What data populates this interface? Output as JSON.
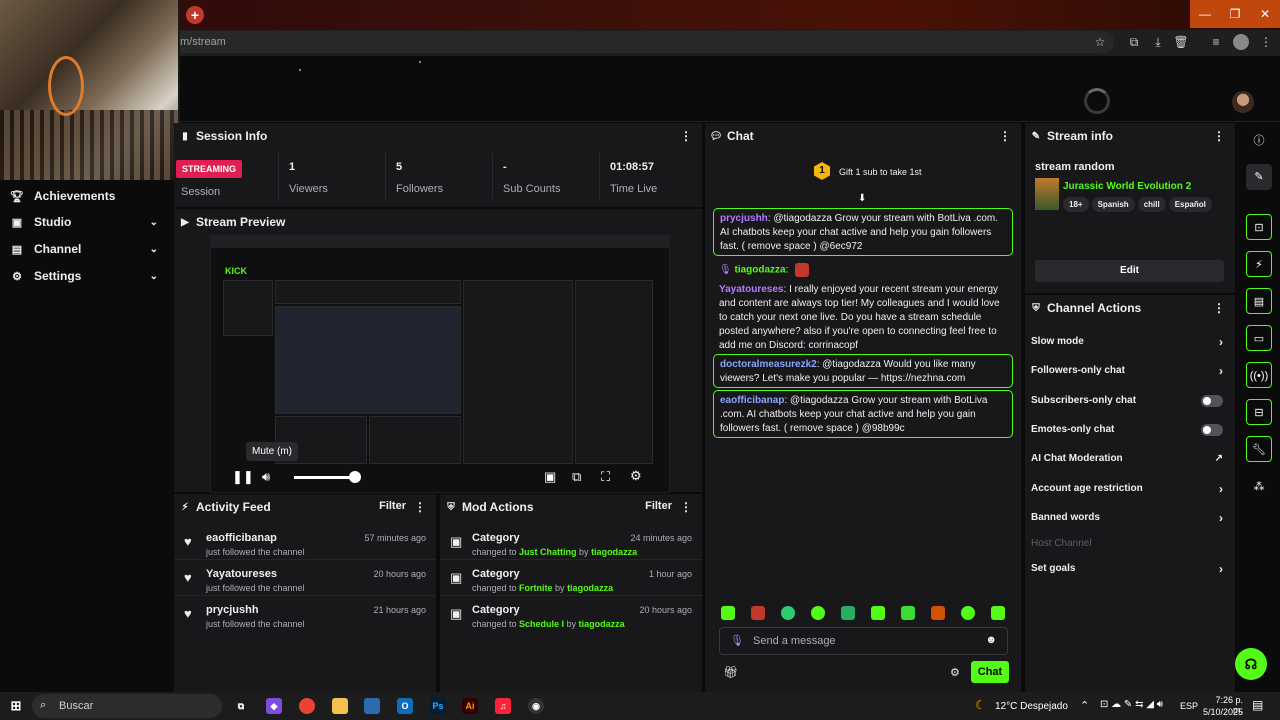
{
  "browser": {
    "url": "m/stream",
    "window_controls": {
      "minimize": "—",
      "maximize": "❐",
      "close": "✕"
    }
  },
  "nav": {
    "items": [
      {
        "label": "Achievements",
        "icon": "trophy-icon",
        "chev": ""
      },
      {
        "label": "Studio",
        "icon": "studio-icon",
        "chev": "⌄"
      },
      {
        "label": "Channel",
        "icon": "channel-icon",
        "chev": "⌄"
      },
      {
        "label": "Settings",
        "icon": "gear-icon",
        "chev": "⌄"
      }
    ]
  },
  "session": {
    "title": "Session Info",
    "status": "STREAMING",
    "status_label": "Session",
    "stats": [
      {
        "value": "1",
        "label": "Viewers"
      },
      {
        "value": "5",
        "label": "Followers"
      },
      {
        "value": "-",
        "label": "Sub Counts"
      },
      {
        "value": "01:08:57",
        "label": "Time Live"
      }
    ]
  },
  "preview": {
    "title": "Stream Preview",
    "tooltip": "Mute (m)",
    "volume_percent": 100,
    "inner_logo": "KICK"
  },
  "activity": {
    "title": "Activity Feed",
    "filter": "Filter",
    "rows": [
      {
        "name": "eaofficibanap",
        "sub": "just followed the channel",
        "time": "57 minutes ago"
      },
      {
        "name": "Yayatoureses",
        "sub": "just followed the channel",
        "time": "20 hours ago"
      },
      {
        "name": "prycjushh",
        "sub": "just followed the channel",
        "time": "21 hours ago"
      }
    ]
  },
  "mod": {
    "title": "Mod Actions",
    "filter": "Filter",
    "rows": [
      {
        "name": "Category",
        "pre": "changed to ",
        "target": "Just Chatting",
        "by": " by ",
        "user": "tiagodazza",
        "time": "24 minutes ago"
      },
      {
        "name": "Category",
        "pre": "changed to ",
        "target": "Fortnite",
        "by": " by ",
        "user": "tiagodazza",
        "time": "1 hour ago"
      },
      {
        "name": "Category",
        "pre": "changed to ",
        "target": "Schedule I",
        "by": " by ",
        "user": "tiagodazza",
        "time": "20 hours ago"
      }
    ]
  },
  "chat": {
    "title": "Chat",
    "gift_text": "Gift 1 sub to take 1st",
    "gift_count": "1",
    "messages": [
      {
        "user": "prycjushh",
        "text": "@tiagodazza Grow your stream with BotLiva .com. AI chatbots keep your chat active and help you gain followers fast. ( remove space ) @6ec972",
        "color": "#b57bff"
      },
      {
        "user": "tiagodazza",
        "text": "",
        "color": "#53fc18"
      },
      {
        "user": "Yayatoureses",
        "text": "I really enjoyed your recent stream your energy and content are always top tier! My colleagues and I would love to catch your next one live. Do you have a stream schedule posted anywhere? also if you're open to connecting feel free to add me on Discord: corrinacopf",
        "color": "#b57bff"
      },
      {
        "user": "doctoralmeasurezk2",
        "text": "@tiagodazza Would you like many viewers? Let's make you popular — https://nezhna.com",
        "color": "#8aa4ff"
      },
      {
        "user": "eaofficibanap",
        "text": "@tiagodazza Grow your stream with BotLiva .com. AI chatbots keep your chat active and help you gain followers fast. ( remove space ) @98b99c",
        "color": "#8aa4ff"
      }
    ],
    "input_placeholder": "Send a message",
    "send_label": "Chat"
  },
  "stream_info": {
    "title": "Stream info",
    "stream_title": "stream random",
    "category": "Jurassic World Evolution 2",
    "tags": [
      "18+",
      "Spanish",
      "chill",
      "Español"
    ],
    "edit_label": "Edit"
  },
  "channel_actions": {
    "title": "Channel Actions",
    "rows": [
      {
        "label": "Slow mode",
        "control": "arrow"
      },
      {
        "label": "Followers-only chat",
        "control": "arrow"
      },
      {
        "label": "Subscribers-only chat",
        "control": "toggle"
      },
      {
        "label": "Emotes-only chat",
        "control": "toggle"
      },
      {
        "label": "AI Chat Moderation",
        "control": "external"
      },
      {
        "label": "Account age restriction",
        "control": "arrow"
      },
      {
        "label": "Banned words",
        "control": "arrow"
      },
      {
        "label": "Host Channel",
        "control": "disabled"
      },
      {
        "label": "Set goals",
        "control": "arrow"
      }
    ]
  },
  "taskbar": {
    "search_placeholder": "Buscar",
    "weather": "12°C Despejado",
    "lang": "ESP",
    "time": "7:26 p. m.",
    "date": "5/10/2025"
  },
  "colors": {
    "accent": "#53fc18",
    "live": "#e01e4f",
    "panel": "#18181b"
  }
}
